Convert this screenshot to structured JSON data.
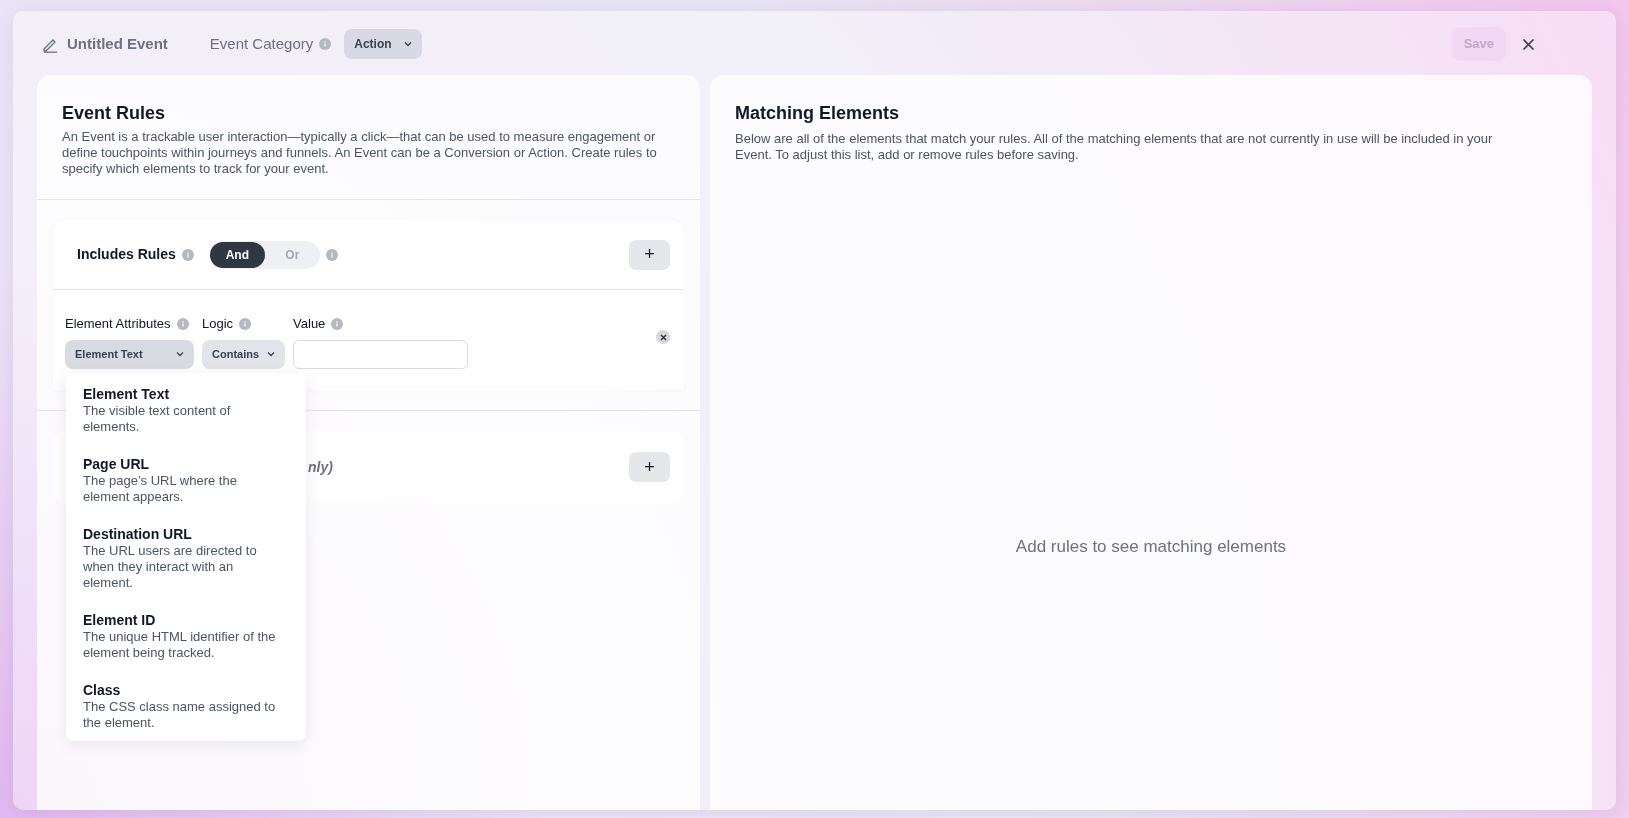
{
  "header": {
    "title": "Untitled Event",
    "category_label": "Event Category",
    "category_value": "Action",
    "save": {
      "label": "Save",
      "disabled": true
    }
  },
  "event_rules": {
    "title": "Event Rules",
    "description": "An Event is a trackable user interaction—typically a click—that can be used to measure engagement or define touchpoints within journeys and funnels. An Event can be a Conversion or Action. Create rules to specify which elements to track for your event."
  },
  "includes": {
    "title": "Includes Rules",
    "toggle": [
      {
        "label": "And",
        "selected": true
      },
      {
        "label": "Or",
        "selected": false
      }
    ],
    "add": "+"
  },
  "rule": {
    "attribute_label": "Element Attributes",
    "attribute_value": "Element Text",
    "logic_label": "Logic",
    "logic_value": "Contains",
    "value_label": "Value"
  },
  "attribute_menu": [
    {
      "title": "Element Text",
      "description": "The visible text content of elements."
    },
    {
      "title": "Page URL",
      "description": "The page’s URL where the element appears."
    },
    {
      "title": "Destination URL",
      "description": "The URL users are directed to when they interact with an element."
    },
    {
      "title": "Element ID",
      "description": "The unique HTML identifier of the element being tracked."
    },
    {
      "title": "Class",
      "description": "The CSS class name assigned to the element."
    }
  ],
  "excludes": {
    "note": "nly)",
    "add": "+"
  },
  "matching": {
    "title": "Matching Elements",
    "description": "Below are all of the elements that match your rules. All of the matching elements that are not currently in use will be included in your Event. To adjust this list, add or remove rules before saving.",
    "empty": "Add rules to see matching elements"
  }
}
